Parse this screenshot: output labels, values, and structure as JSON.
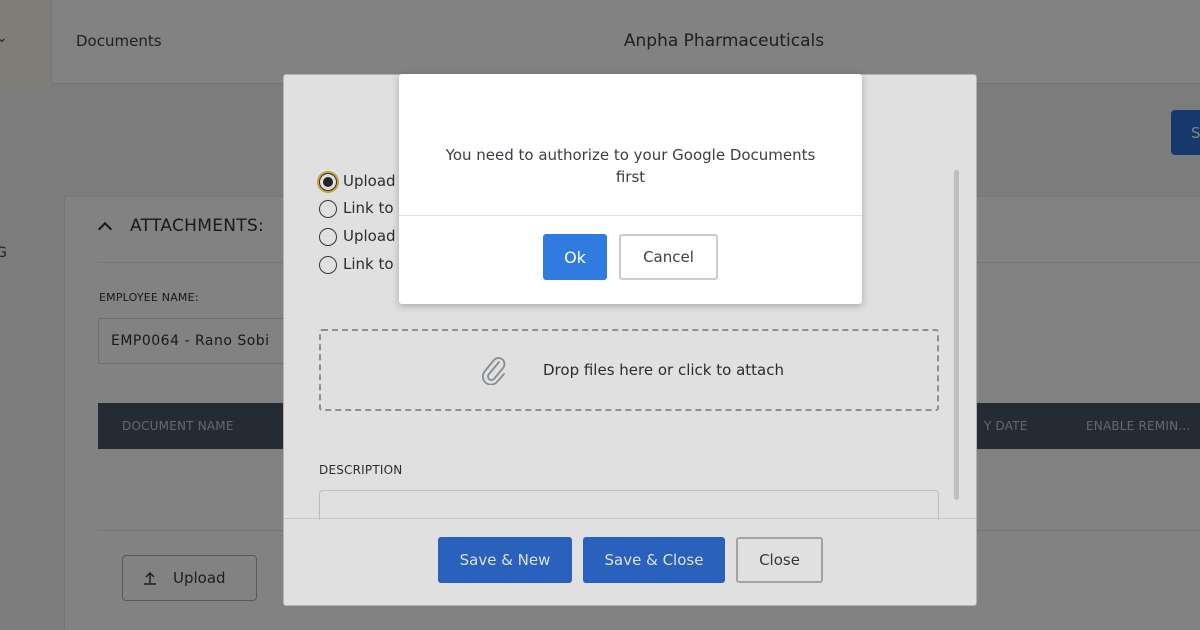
{
  "topbar": {
    "chevron": "⌄",
    "section_label": "Documents",
    "company_name": "Anpha Pharmaceuticals"
  },
  "page": {
    "save_button_partial": "S",
    "side_partial": "G",
    "attachments_title": "ATTACHMENTS:",
    "employee_label": "EMPLOYEE NAME:",
    "employee_value": "EMP0064 - Rano Sobi",
    "table_columns": [
      "DOCUMENT NAME",
      "Y DATE",
      "ENABLE REMIN..."
    ],
    "upload_label": "Upload"
  },
  "attach_modal": {
    "options": [
      {
        "label": "Upload",
        "selected": true
      },
      {
        "label": "Link to",
        "selected": false
      },
      {
        "label": "Upload",
        "selected": false
      },
      {
        "label": "Link to",
        "selected": false
      }
    ],
    "dropzone_text": "Drop files here or click to attach",
    "description_label": "DESCRIPTION",
    "buttons": {
      "save_new": "Save & New",
      "save_close": "Save & Close",
      "close": "Close"
    }
  },
  "auth_dialog": {
    "message": "You need to authorize to your Google Documents first",
    "ok_label": "Ok",
    "cancel_label": "Cancel"
  },
  "colors": {
    "primary": "#2f6fd6",
    "table_header": "#4b5663",
    "radio_focus": "#e7b53a"
  }
}
